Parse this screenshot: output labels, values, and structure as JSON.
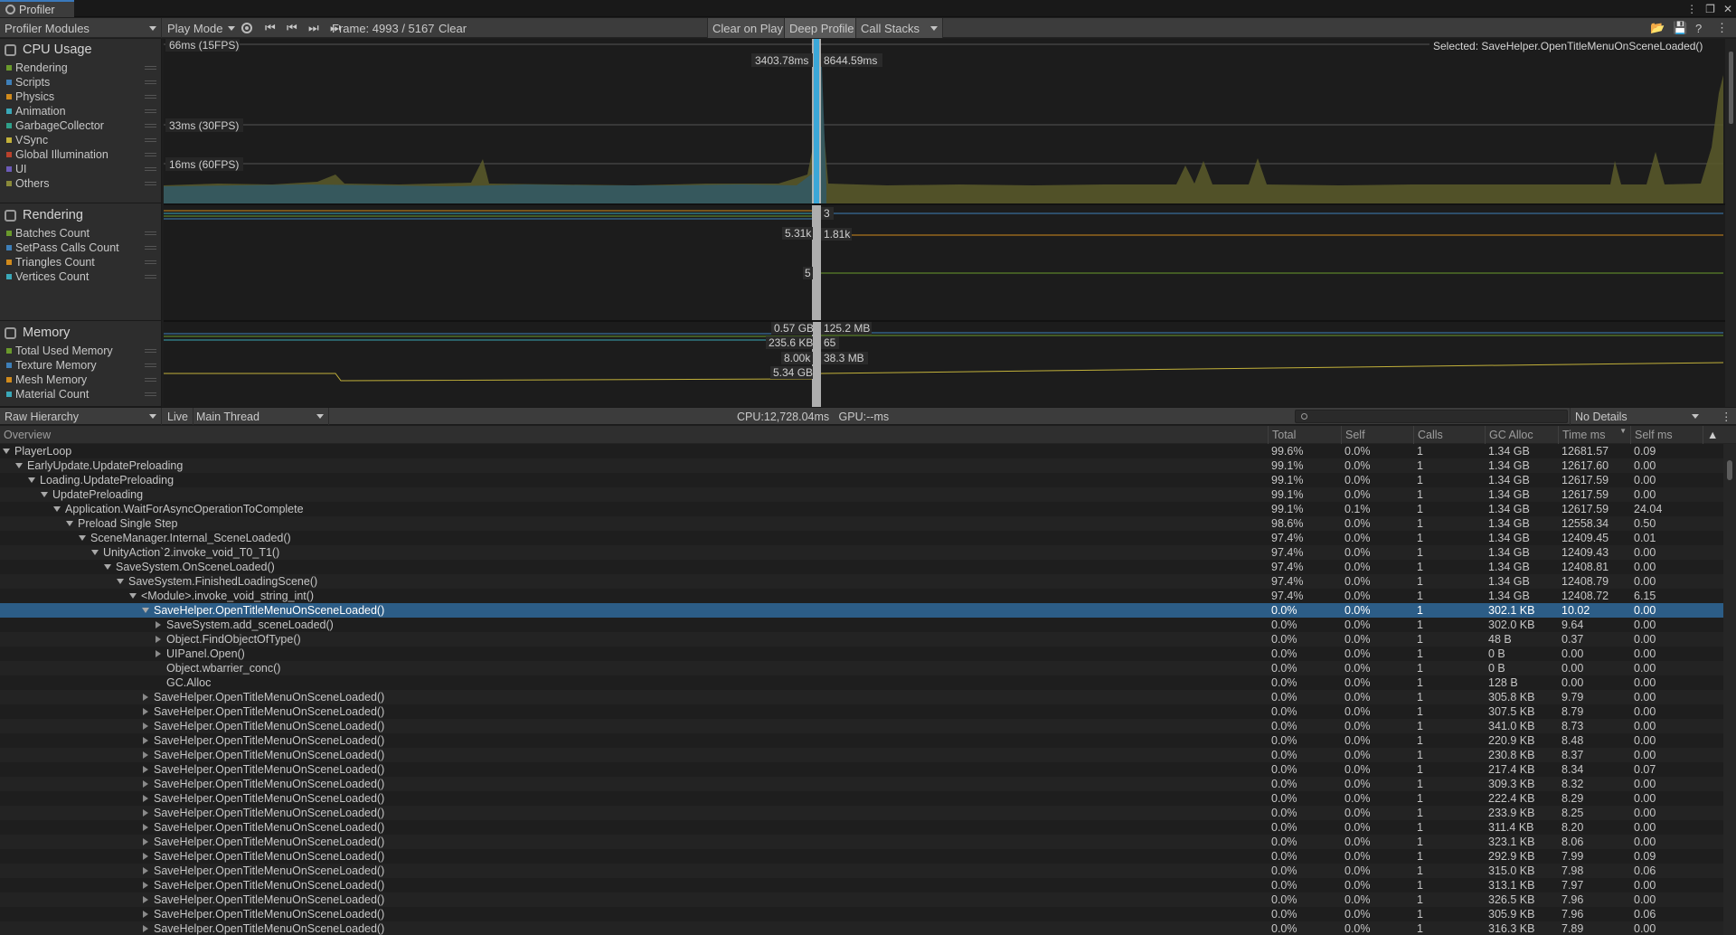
{
  "window": {
    "tab_title": "Profiler"
  },
  "toolbar": {
    "modules_label": "Profiler Modules",
    "play_mode": "Play Mode",
    "frame": "Frame: 4993 / 5167",
    "clear": "Clear",
    "clear_on_play": "Clear on Play",
    "deep_profile": "Deep Profile",
    "call_stacks": "Call Stacks"
  },
  "modules": [
    {
      "title": "CPU Usage",
      "legend": [
        {
          "label": "Rendering",
          "color": "#6a9a2c"
        },
        {
          "label": "Scripts",
          "color": "#3e7fb8"
        },
        {
          "label": "Physics",
          "color": "#d08a1c"
        },
        {
          "label": "Animation",
          "color": "#3aa8b8"
        },
        {
          "label": "GarbageCollector",
          "color": "#2fa08a"
        },
        {
          "label": "VSync",
          "color": "#c2b13a"
        },
        {
          "label": "Global Illumination",
          "color": "#b8412c"
        },
        {
          "label": "UI",
          "color": "#6c5bb8"
        },
        {
          "label": "Others",
          "color": "#8a8a3a"
        }
      ]
    },
    {
      "title": "Rendering",
      "legend": [
        {
          "label": "Batches Count",
          "color": "#6a9a2c"
        },
        {
          "label": "SetPass Calls Count",
          "color": "#3e7fb8"
        },
        {
          "label": "Triangles Count",
          "color": "#d08a1c"
        },
        {
          "label": "Vertices Count",
          "color": "#3aa8b8"
        }
      ]
    },
    {
      "title": "Memory",
      "legend": [
        {
          "label": "Total Used Memory",
          "color": "#6a9a2c"
        },
        {
          "label": "Texture Memory",
          "color": "#3e7fb8"
        },
        {
          "label": "Mesh Memory",
          "color": "#d08a1c"
        },
        {
          "label": "Material Count",
          "color": "#3aa8b8"
        }
      ]
    }
  ],
  "cpu_chart": {
    "fps_lines": [
      "66ms (15FPS)",
      "33ms (30FPS)",
      "16ms (60FPS)"
    ],
    "selected_values": [
      "3403.78ms",
      "8644.59ms"
    ],
    "selected_label": "Selected: SaveHelper.OpenTitleMenuOnSceneLoaded()"
  },
  "render_chart": {
    "labels": [
      "3",
      "5.31k",
      "1.81k",
      "5"
    ]
  },
  "memory_chart": {
    "labels": [
      "0.57 GB",
      "125.2 MB",
      "235.6 KB",
      "65",
      "8.00k",
      "38.3 MB",
      "5.34 GB"
    ]
  },
  "hierarchy_toolbar": {
    "view": "Raw Hierarchy",
    "live": "Live",
    "thread": "Main Thread",
    "stats": "CPU:12,728.04ms   GPU:--ms",
    "details": "No Details"
  },
  "columns": [
    "Overview",
    "Total",
    "Self",
    "Calls",
    "GC Alloc",
    "Time ms",
    "Self ms"
  ],
  "rows": [
    {
      "depth": 0,
      "state": "exp",
      "name": "PlayerLoop",
      "total": "99.6%",
      "self": "0.0%",
      "calls": "1",
      "gc": "1.34 GB",
      "time": "12681.57",
      "selfms": "0.09"
    },
    {
      "depth": 1,
      "state": "exp",
      "name": "EarlyUpdate.UpdatePreloading",
      "total": "99.1%",
      "self": "0.0%",
      "calls": "1",
      "gc": "1.34 GB",
      "time": "12617.60",
      "selfms": "0.00"
    },
    {
      "depth": 2,
      "state": "exp",
      "name": "Loading.UpdatePreloading",
      "total": "99.1%",
      "self": "0.0%",
      "calls": "1",
      "gc": "1.34 GB",
      "time": "12617.59",
      "selfms": "0.00"
    },
    {
      "depth": 3,
      "state": "exp",
      "name": "UpdatePreloading",
      "total": "99.1%",
      "self": "0.0%",
      "calls": "1",
      "gc": "1.34 GB",
      "time": "12617.59",
      "selfms": "0.00"
    },
    {
      "depth": 4,
      "state": "exp",
      "name": "Application.WaitForAsyncOperationToComplete",
      "total": "99.1%",
      "self": "0.1%",
      "calls": "1",
      "gc": "1.34 GB",
      "time": "12617.59",
      "selfms": "24.04"
    },
    {
      "depth": 5,
      "state": "exp",
      "name": "Preload Single Step",
      "total": "98.6%",
      "self": "0.0%",
      "calls": "1",
      "gc": "1.34 GB",
      "time": "12558.34",
      "selfms": "0.50"
    },
    {
      "depth": 6,
      "state": "exp",
      "name": "SceneManager.Internal_SceneLoaded()",
      "total": "97.4%",
      "self": "0.0%",
      "calls": "1",
      "gc": "1.34 GB",
      "time": "12409.45",
      "selfms": "0.01"
    },
    {
      "depth": 7,
      "state": "exp",
      "name": "UnityAction`2.invoke_void_T0_T1()",
      "total": "97.4%",
      "self": "0.0%",
      "calls": "1",
      "gc": "1.34 GB",
      "time": "12409.43",
      "selfms": "0.00"
    },
    {
      "depth": 8,
      "state": "exp",
      "name": "SaveSystem.OnSceneLoaded()",
      "total": "97.4%",
      "self": "0.0%",
      "calls": "1",
      "gc": "1.34 GB",
      "time": "12408.81",
      "selfms": "0.00"
    },
    {
      "depth": 9,
      "state": "exp",
      "name": "SaveSystem.FinishedLoadingScene()",
      "total": "97.4%",
      "self": "0.0%",
      "calls": "1",
      "gc": "1.34 GB",
      "time": "12408.79",
      "selfms": "0.00"
    },
    {
      "depth": 10,
      "state": "exp",
      "name": "<Module>.invoke_void_string_int()",
      "total": "97.4%",
      "self": "0.0%",
      "calls": "1",
      "gc": "1.34 GB",
      "time": "12408.72",
      "selfms": "6.15"
    },
    {
      "depth": 11,
      "state": "exp",
      "name": "SaveHelper.OpenTitleMenuOnSceneLoaded()",
      "total": "0.0%",
      "self": "0.0%",
      "calls": "1",
      "gc": "302.1 KB",
      "time": "10.02",
      "selfms": "0.00",
      "selected": true
    },
    {
      "depth": 12,
      "state": "col",
      "name": "SaveSystem.add_sceneLoaded()",
      "total": "0.0%",
      "self": "0.0%",
      "calls": "1",
      "gc": "302.0 KB",
      "time": "9.64",
      "selfms": "0.00"
    },
    {
      "depth": 12,
      "state": "col",
      "name": "Object.FindObjectOfType()",
      "total": "0.0%",
      "self": "0.0%",
      "calls": "1",
      "gc": "48 B",
      "time": "0.37",
      "selfms": "0.00"
    },
    {
      "depth": 12,
      "state": "col",
      "name": "UIPanel.Open()",
      "total": "0.0%",
      "self": "0.0%",
      "calls": "1",
      "gc": "0 B",
      "time": "0.00",
      "selfms": "0.00"
    },
    {
      "depth": 12,
      "state": "none",
      "name": "Object.wbarrier_conc()",
      "total": "0.0%",
      "self": "0.0%",
      "calls": "1",
      "gc": "0 B",
      "time": "0.00",
      "selfms": "0.00"
    },
    {
      "depth": 12,
      "state": "none",
      "name": "GC.Alloc",
      "total": "0.0%",
      "self": "0.0%",
      "calls": "1",
      "gc": "128 B",
      "time": "0.00",
      "selfms": "0.00"
    },
    {
      "depth": 11,
      "state": "col",
      "name": "SaveHelper.OpenTitleMenuOnSceneLoaded()",
      "total": "0.0%",
      "self": "0.0%",
      "calls": "1",
      "gc": "305.8 KB",
      "time": "9.79",
      "selfms": "0.00"
    },
    {
      "depth": 11,
      "state": "col",
      "name": "SaveHelper.OpenTitleMenuOnSceneLoaded()",
      "total": "0.0%",
      "self": "0.0%",
      "calls": "1",
      "gc": "307.5 KB",
      "time": "8.79",
      "selfms": "0.00"
    },
    {
      "depth": 11,
      "state": "col",
      "name": "SaveHelper.OpenTitleMenuOnSceneLoaded()",
      "total": "0.0%",
      "self": "0.0%",
      "calls": "1",
      "gc": "341.0 KB",
      "time": "8.73",
      "selfms": "0.00"
    },
    {
      "depth": 11,
      "state": "col",
      "name": "SaveHelper.OpenTitleMenuOnSceneLoaded()",
      "total": "0.0%",
      "self": "0.0%",
      "calls": "1",
      "gc": "220.9 KB",
      "time": "8.48",
      "selfms": "0.00"
    },
    {
      "depth": 11,
      "state": "col",
      "name": "SaveHelper.OpenTitleMenuOnSceneLoaded()",
      "total": "0.0%",
      "self": "0.0%",
      "calls": "1",
      "gc": "230.8 KB",
      "time": "8.37",
      "selfms": "0.00"
    },
    {
      "depth": 11,
      "state": "col",
      "name": "SaveHelper.OpenTitleMenuOnSceneLoaded()",
      "total": "0.0%",
      "self": "0.0%",
      "calls": "1",
      "gc": "217.4 KB",
      "time": "8.34",
      "selfms": "0.07"
    },
    {
      "depth": 11,
      "state": "col",
      "name": "SaveHelper.OpenTitleMenuOnSceneLoaded()",
      "total": "0.0%",
      "self": "0.0%",
      "calls": "1",
      "gc": "309.3 KB",
      "time": "8.32",
      "selfms": "0.00"
    },
    {
      "depth": 11,
      "state": "col",
      "name": "SaveHelper.OpenTitleMenuOnSceneLoaded()",
      "total": "0.0%",
      "self": "0.0%",
      "calls": "1",
      "gc": "222.4 KB",
      "time": "8.29",
      "selfms": "0.00"
    },
    {
      "depth": 11,
      "state": "col",
      "name": "SaveHelper.OpenTitleMenuOnSceneLoaded()",
      "total": "0.0%",
      "self": "0.0%",
      "calls": "1",
      "gc": "233.9 KB",
      "time": "8.25",
      "selfms": "0.00"
    },
    {
      "depth": 11,
      "state": "col",
      "name": "SaveHelper.OpenTitleMenuOnSceneLoaded()",
      "total": "0.0%",
      "self": "0.0%",
      "calls": "1",
      "gc": "311.4 KB",
      "time": "8.20",
      "selfms": "0.00"
    },
    {
      "depth": 11,
      "state": "col",
      "name": "SaveHelper.OpenTitleMenuOnSceneLoaded()",
      "total": "0.0%",
      "self": "0.0%",
      "calls": "1",
      "gc": "323.1 KB",
      "time": "8.06",
      "selfms": "0.00"
    },
    {
      "depth": 11,
      "state": "col",
      "name": "SaveHelper.OpenTitleMenuOnSceneLoaded()",
      "total": "0.0%",
      "self": "0.0%",
      "calls": "1",
      "gc": "292.9 KB",
      "time": "7.99",
      "selfms": "0.09"
    },
    {
      "depth": 11,
      "state": "col",
      "name": "SaveHelper.OpenTitleMenuOnSceneLoaded()",
      "total": "0.0%",
      "self": "0.0%",
      "calls": "1",
      "gc": "315.0 KB",
      "time": "7.98",
      "selfms": "0.06"
    },
    {
      "depth": 11,
      "state": "col",
      "name": "SaveHelper.OpenTitleMenuOnSceneLoaded()",
      "total": "0.0%",
      "self": "0.0%",
      "calls": "1",
      "gc": "313.1 KB",
      "time": "7.97",
      "selfms": "0.00"
    },
    {
      "depth": 11,
      "state": "col",
      "name": "SaveHelper.OpenTitleMenuOnSceneLoaded()",
      "total": "0.0%",
      "self": "0.0%",
      "calls": "1",
      "gc": "326.5 KB",
      "time": "7.96",
      "selfms": "0.00"
    },
    {
      "depth": 11,
      "state": "col",
      "name": "SaveHelper.OpenTitleMenuOnSceneLoaded()",
      "total": "0.0%",
      "self": "0.0%",
      "calls": "1",
      "gc": "305.9 KB",
      "time": "7.96",
      "selfms": "0.06"
    },
    {
      "depth": 11,
      "state": "col",
      "name": "SaveHelper.OpenTitleMenuOnSceneLoaded()",
      "total": "0.0%",
      "self": "0.0%",
      "calls": "1",
      "gc": "316.3 KB",
      "time": "7.89",
      "selfms": "0.00"
    }
  ]
}
